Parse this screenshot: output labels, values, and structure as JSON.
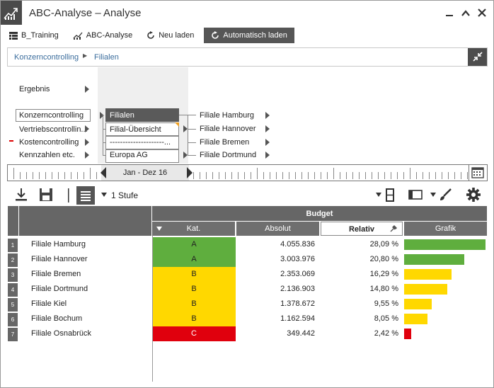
{
  "window": {
    "title": "ABC-Analyse – Analyse"
  },
  "toolbar": {
    "items": [
      {
        "label": "B_Training",
        "icon": "table-icon"
      },
      {
        "label": "ABC-Analyse",
        "icon": "chart-icon"
      },
      {
        "label": "Neu laden",
        "icon": "refresh-icon"
      },
      {
        "label": "Automatisch laden",
        "icon": "auto-refresh-icon",
        "active": true
      }
    ]
  },
  "breadcrumb": {
    "items": [
      "Konzerncontrolling",
      "Filialen"
    ]
  },
  "navigator": {
    "col1": [
      "Ergebnis",
      "Konzerncontrolling",
      "Vertriebscontrollin...",
      "Kostencontrolling",
      "Kennzahlen etc."
    ],
    "col2": [
      "Filialen",
      "Filial-Übersicht",
      "---------------------...",
      "Europa AG"
    ],
    "col3": [
      "Filiale Hamburg",
      "Filiale Hannover",
      "Filiale Bremen",
      "Filiale Dortmund"
    ]
  },
  "timeline": {
    "period": "Jan - Dez 16"
  },
  "report_toolbar": {
    "level": "1 Stufe"
  },
  "table": {
    "group_header": "Budget",
    "columns": [
      "Kat.",
      "Absolut",
      "Relativ",
      "Grafik"
    ],
    "rows": [
      {
        "num": "1",
        "name": "Filiale Hamburg",
        "kat": "A",
        "absolut": "4.055.836",
        "relativ": "28,09 %",
        "bar": 28.09
      },
      {
        "num": "2",
        "name": "Filiale Hannover",
        "kat": "A",
        "absolut": "3.003.976",
        "relativ": "20,80 %",
        "bar": 20.8
      },
      {
        "num": "3",
        "name": "Filiale Bremen",
        "kat": "B",
        "absolut": "2.353.069",
        "relativ": "16,29 %",
        "bar": 16.29
      },
      {
        "num": "4",
        "name": "Filiale Dortmund",
        "kat": "B",
        "absolut": "2.136.903",
        "relativ": "14,80 %",
        "bar": 14.8
      },
      {
        "num": "5",
        "name": "Filiale Kiel",
        "kat": "B",
        "absolut": "1.378.672",
        "relativ": "9,55 %",
        "bar": 9.55
      },
      {
        "num": "6",
        "name": "Filiale Bochum",
        "kat": "B",
        "absolut": "1.162.594",
        "relativ": "8,05 %",
        "bar": 8.05
      },
      {
        "num": "7",
        "name": "Filiale Osnabrück",
        "kat": "C",
        "absolut": "349.442",
        "relativ": "2,42 %",
        "bar": 2.42
      }
    ],
    "colors": {
      "A": "#5fae3e",
      "B": "#ffd800",
      "C": "#e0000d"
    }
  }
}
